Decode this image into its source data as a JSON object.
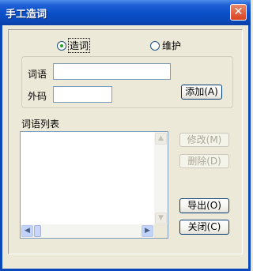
{
  "window": {
    "title": "手工造词",
    "close_glyph": "✕"
  },
  "mode": {
    "options": [
      {
        "label": "造词",
        "checked": true
      },
      {
        "label": "维护",
        "checked": false
      }
    ]
  },
  "form": {
    "word_label": "词语",
    "word_value": "",
    "code_label": "外码",
    "code_value": "",
    "add_button": "添加(A)"
  },
  "list": {
    "label": "词语列表",
    "items": []
  },
  "buttons": {
    "modify": "修改(M)",
    "delete": "删除(D)",
    "export": "导出(O)",
    "close": "关闭(C)"
  },
  "colors": {
    "titlebar": "#0a4fc7",
    "dialog_bg": "#ece9d8",
    "close_button": "#d9421f"
  }
}
